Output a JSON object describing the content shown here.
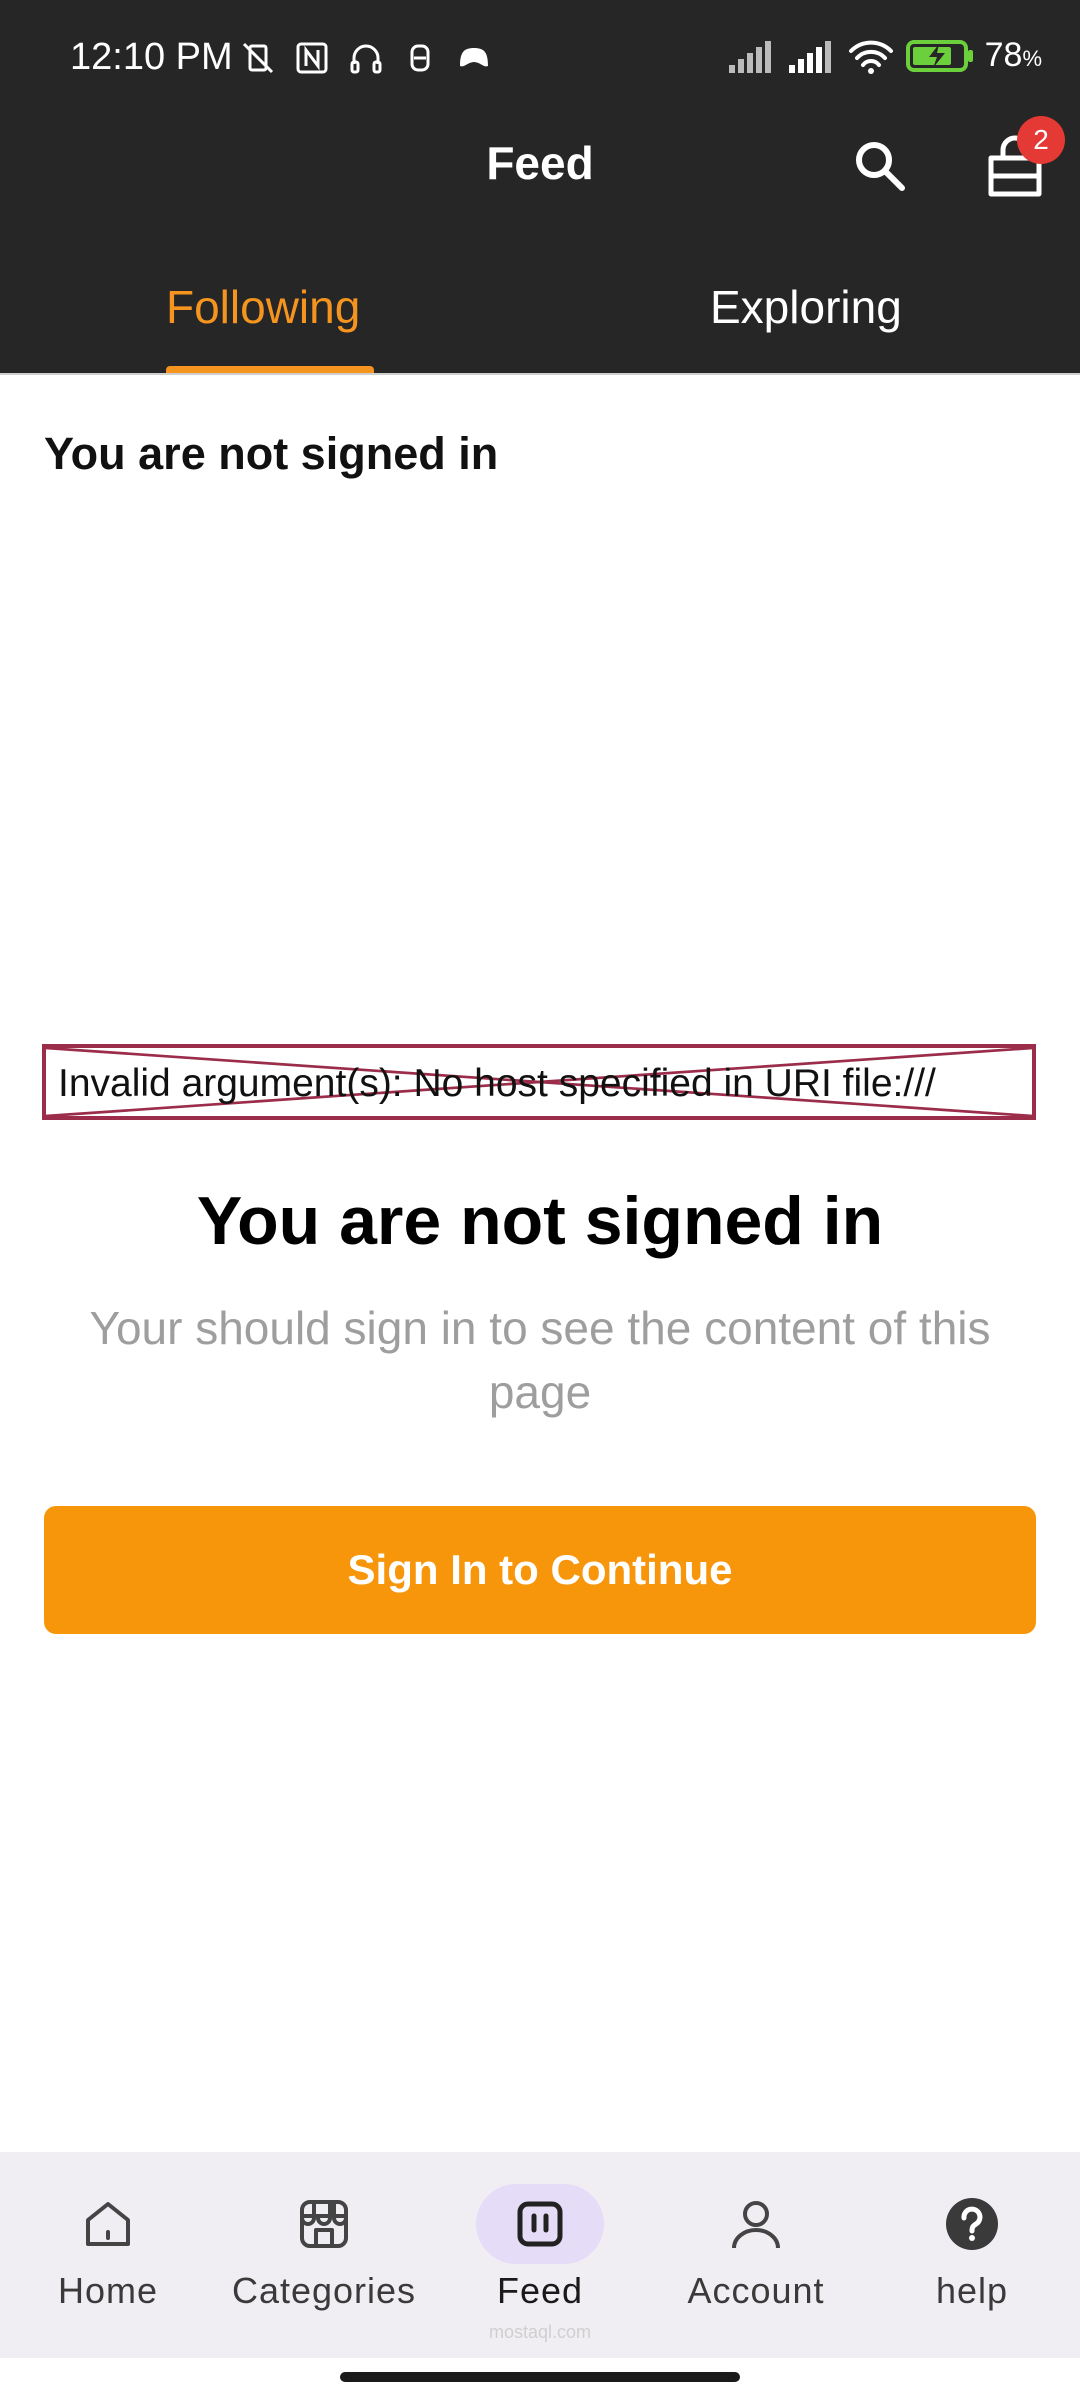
{
  "status_bar": {
    "time": "12:10 PM",
    "battery": "78",
    "battery_unit": "%"
  },
  "header": {
    "title": "Feed",
    "cart_badge": "2"
  },
  "tabs": [
    {
      "label": "Following",
      "active": true
    },
    {
      "label": "Exploring",
      "active": false
    }
  ],
  "content": {
    "top_heading": "You are not signed in",
    "broken_image_text": "Invalid argument(s): No host specified in URI file:///",
    "empty_title": "You are not signed in",
    "empty_subtitle": "Your should sign in to see the content of this page",
    "signin_button": "Sign In to Continue"
  },
  "bottom_nav": {
    "items": [
      {
        "label": "Home",
        "icon": "home-icon"
      },
      {
        "label": "Categories",
        "icon": "store-icon"
      },
      {
        "label": "Feed",
        "icon": "feed-icon",
        "active": true
      },
      {
        "label": "Account",
        "icon": "person-icon"
      },
      {
        "label": "help",
        "icon": "help-icon"
      }
    ],
    "watermark": "mostaql.com"
  },
  "colors": {
    "accent": "#f5951f",
    "button": "#f7960a",
    "topbar": "#262626",
    "badge": "#e53935",
    "active_pill": "#e5dcf7"
  }
}
